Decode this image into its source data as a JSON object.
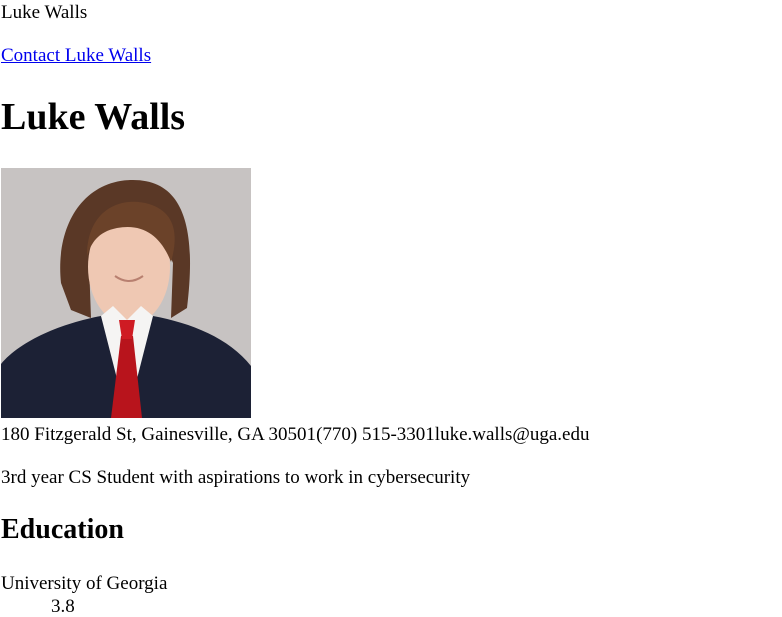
{
  "header": {
    "site_name": "Luke Walls",
    "contact_link": "Contact Luke Walls"
  },
  "profile": {
    "name": "Luke Walls",
    "address": "180 Fitzgerald St, Gainesville, GA 30501",
    "phone": "(770) 515-3301",
    "email": "luke.walls@uga.edu",
    "summary": "3rd year CS Student with aspirations to work in cybersecurity"
  },
  "education": {
    "heading": "Education",
    "school": "University of Georgia",
    "gpa": "3.8"
  }
}
